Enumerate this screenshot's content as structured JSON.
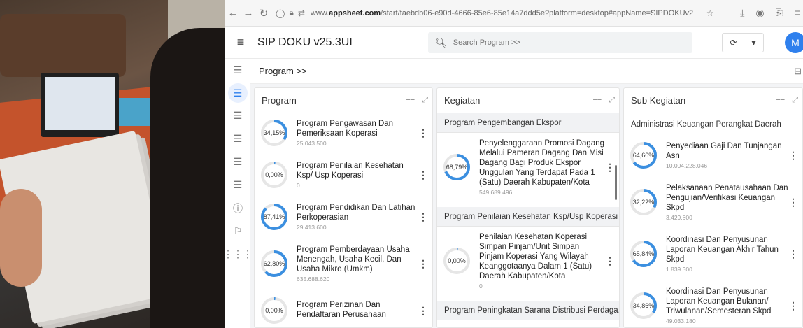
{
  "browser": {
    "url_prefix": "www.",
    "url_domain": "appsheet.com",
    "url_rest": "/start/faebdb06-e90d-4666-85e6-85e14a7ddd5e?platform=desktop#appName=SIPDOKUv2"
  },
  "app": {
    "title": "SIP DOKU v25.3UI",
    "search_placeholder": "Search Program >>",
    "avatar_initial": "M"
  },
  "breadcrumb": "Program >>",
  "panels": {
    "program": {
      "title": "Program",
      "rows": [
        {
          "pct": "34,15%",
          "value": 0.3415,
          "title": "Program Pengawasan Dan Pemeriksaan Koperasi",
          "sub": "25.043.500"
        },
        {
          "pct": "0,00%",
          "value": 0.0,
          "title": "Program Penilaian Kesehatan Ksp/ Usp Koperasi",
          "sub": "0"
        },
        {
          "pct": "87,41%",
          "value": 0.8741,
          "title": "Program Pendidikan Dan Latihan Perkoperasian",
          "sub": "29.413.600"
        },
        {
          "pct": "62,80%",
          "value": 0.628,
          "title": "Program Pemberdayaan Usaha Menengah, Usaha Kecil, Dan Usaha Mikro (Umkm)",
          "sub": "635.688.620"
        },
        {
          "pct": "0,00%",
          "value": 0.0,
          "title": "Program Perizinan Dan Pendaftaran Perusahaan",
          "sub": ""
        }
      ]
    },
    "kegiatan": {
      "title": "Kegiatan",
      "groups": [
        {
          "name": "Program Pengembangan Ekspor",
          "rows": [
            {
              "pct": "68,79%",
              "value": 0.6879,
              "title": "Penyelenggaraan Promosi Dagang Melalui Pameran Dagang Dan Misi Dagang Bagi Produk Ekspor Unggulan Yang Terdapat Pada 1 (Satu) Daerah Kabupaten/Kota",
              "sub": "549.689.496"
            }
          ]
        },
        {
          "name": "Program Penilaian Kesehatan Ksp/Usp Koperasi",
          "rows": [
            {
              "pct": "0,00%",
              "value": 0.0,
              "title": "Penilaian Kesehatan Koperasi Simpan Pinjam/Unit Simpan Pinjam Koperasi Yang Wilayah Keanggotaanya Dalam 1 (Satu) Daerah Kabupaten/Kota",
              "sub": "0"
            }
          ]
        },
        {
          "name": "Program Peningkatan Sarana Distribusi Perdaga...",
          "rows": []
        }
      ]
    },
    "subkegiatan": {
      "title": "Sub Kegiatan",
      "group": "Administrasi Keuangan Perangkat Daerah",
      "rows": [
        {
          "pct": "64,66%",
          "value": 0.6466,
          "title": "Penyediaan Gaji Dan Tunjangan Asn",
          "sub": "10.004.228.046"
        },
        {
          "pct": "32,22%",
          "value": 0.3222,
          "title": "Pelaksanaan Penatausahaan Dan Pengujian/Verifikasi Keuangan Skpd",
          "sub": "3.429.600"
        },
        {
          "pct": "65,84%",
          "value": 0.6584,
          "title": "Koordinasi Dan Penyusunan Laporan Keuangan Akhir Tahun Skpd",
          "sub": "1.839.300"
        },
        {
          "pct": "34,86%",
          "value": 0.3486,
          "title": "Koordinasi Dan Penyusunan Laporan Keuangan Bulanan/ Triwulanan/Semesteran Skpd",
          "sub": "49.033.180"
        }
      ]
    }
  },
  "colors": {
    "accent": "#2f80ed",
    "ring_track": "#e6e6e6",
    "ring_fill": "#3b8fe0"
  }
}
